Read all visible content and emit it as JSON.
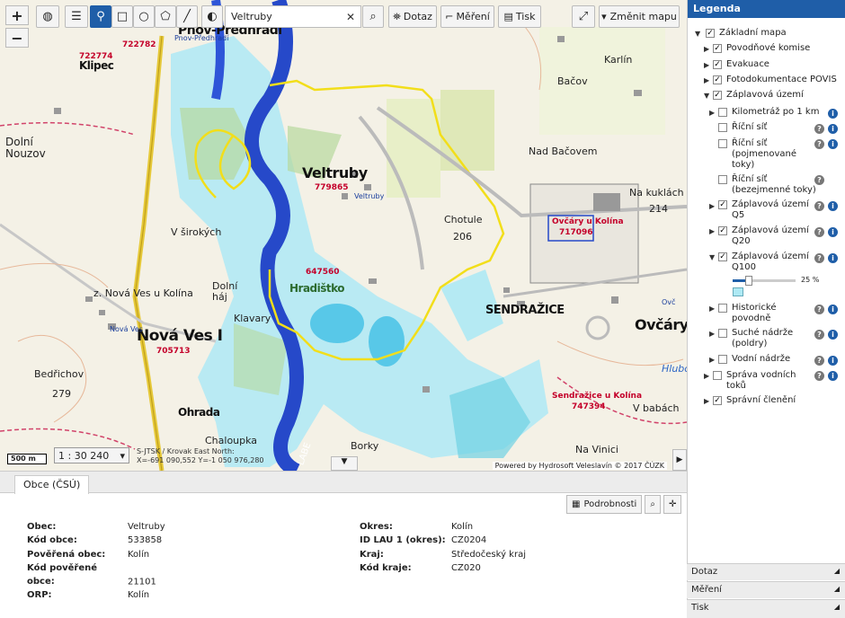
{
  "toolbar": {
    "search_value": "Veltruby",
    "dotaz": "Dotaz",
    "mereni": "Měření",
    "tisk": "Tisk",
    "zmenit_mapu": "Změnit mapu"
  },
  "map": {
    "places": {
      "pnov": "Pnov-Předhradí",
      "klipec": "Klipec",
      "dolni_nouzov": "Dolní\nNouzov",
      "veltruby": "Veltruby",
      "v_sirokych": "V širokých",
      "dolni_haj": "Dolní\nháj",
      "hradistko": "Hradištko",
      "klavary": "Klavary",
      "nova_ves_kolin": "z. Nová Ves u Kolína",
      "nova_ves": "Nová Ves I",
      "bedrichov": "Bedřichov",
      "ohrada": "Ohrada",
      "chaloupka": "Chaloupka",
      "borky": "Borky",
      "chotule": "Chotule",
      "sendrazice": "SENDRAŽICE",
      "ovcary": "Ovčáry",
      "nad_bacovem": "Nad Bačovem",
      "bacov": "Bačov",
      "karlin": "Karlín",
      "na_kuklach": "Na kuklách",
      "v_babach": "V babách",
      "na_vinici": "Na Vinici",
      "hlubo": "Hlubo",
      "labe": "LABE"
    },
    "codes": {
      "c722774": "722774",
      "c722782": "722782",
      "c779865": "779865",
      "c647560": "647560",
      "c705713": "705713",
      "c717096": "717096",
      "c747394": "747394",
      "ovcary_kolin": "Ovčáry u Kolína",
      "sendrazice_kolin": "Sendražice u Kolína"
    },
    "poi": {
      "pnov_pt": "Pnov-Předhradí",
      "veltruby_pt": "Veltruby",
      "nova_ves_pt": "Nová Ves",
      "ovc_pt": "Ovč"
    },
    "heights": {
      "h279": "279",
      "h206": "206",
      "h214": "214"
    },
    "scalebar": "500 m",
    "scale": "1 : 30 240",
    "coords_line1": "S-JTSK / Krovak East North:",
    "coords_line2": "X=-691 090,552 Y=-1 050 976,280",
    "attribution": "Powered by Hydrosoft Veleslavín © 2017 ČÚZK"
  },
  "bottom": {
    "tab": "Obce (ČSÚ)",
    "details_button": "Podrobnosti",
    "left": [
      {
        "k": "Obec:",
        "v": "Veltruby"
      },
      {
        "k": "Kód obce:",
        "v": "533858"
      },
      {
        "k": "Pověřená obec:",
        "v": "Kolín"
      },
      {
        "k": "Kód pověřené obce:",
        "v": "21101"
      },
      {
        "k": "ORP:",
        "v": "Kolín"
      }
    ],
    "right": [
      {
        "k": "Okres:",
        "v": "Kolín"
      },
      {
        "k": "ID LAU 1 (okres):",
        "v": "CZ0204"
      },
      {
        "k": "Kraj:",
        "v": "Středočeský kraj"
      },
      {
        "k": "Kód kraje:",
        "v": "CZ020"
      }
    ]
  },
  "legend": {
    "title": "Legenda",
    "items": [
      "Základní mapa",
      "Povodňové komise",
      "Evakuace",
      "Fotodokumentace POVIS",
      "Záplavová území",
      "Kilometráž po 1 km",
      "Říční síť",
      "Říční síť (pojmenované toky)",
      "Říční síť (bezejmenné toky)",
      "Záplavová území Q5",
      "Záplavová území Q20",
      "Záplavová území Q100",
      "Historické povodně",
      "Suché nádrže (poldry)",
      "Vodní nádrže",
      "Správa vodních toků",
      "Správní členění"
    ],
    "opacity": "25 %",
    "accordions": [
      "Dotaz",
      "Měření",
      "Tisk"
    ]
  }
}
